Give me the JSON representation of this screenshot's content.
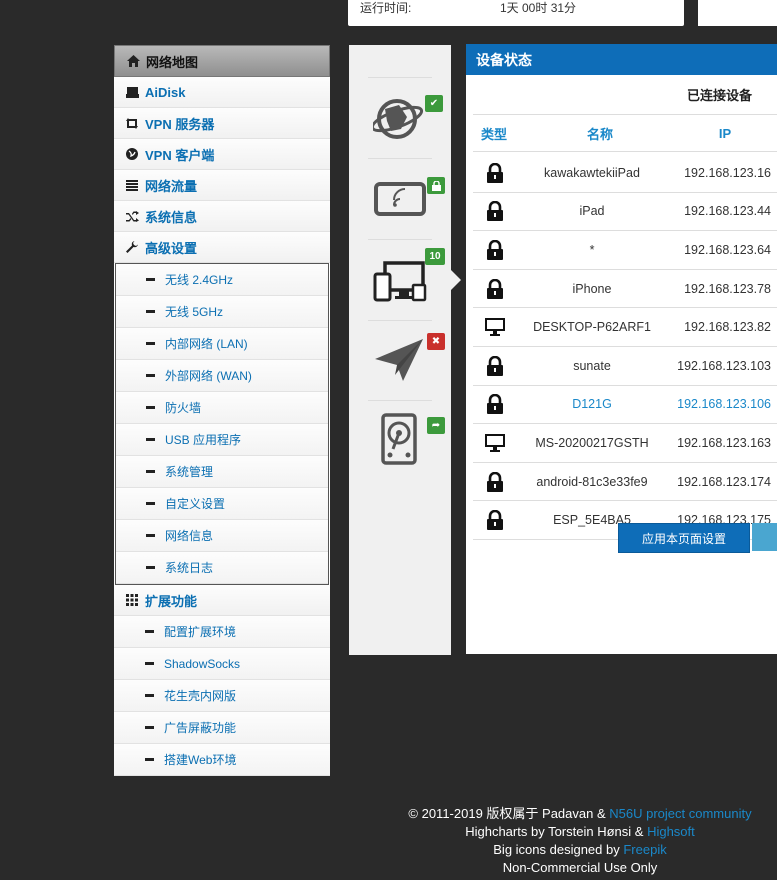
{
  "top": {
    "uptime_label": "运行时间:",
    "uptime_value": "1天 00时 31分"
  },
  "sidebar": {
    "items": [
      {
        "label": "网络地图",
        "icon": "home-icon"
      },
      {
        "label": "AiDisk",
        "icon": "disk-icon"
      },
      {
        "label": "VPN 服务器",
        "icon": "retweet-icon"
      },
      {
        "label": "VPN 客户端",
        "icon": "globe-icon"
      },
      {
        "label": "网络流量",
        "icon": "list-icon"
      },
      {
        "label": "系统信息",
        "icon": "random-icon"
      },
      {
        "label": "高级设置",
        "icon": "wrench-icon"
      }
    ],
    "advanced": [
      "无线 2.4GHz",
      "无线 5GHz",
      "内部网络 (LAN)",
      "外部网络 (WAN)",
      "防火墙",
      "USB 应用程序",
      "系统管理",
      "自定义设置",
      "网络信息",
      "系统日志"
    ],
    "ext_label": "扩展功能",
    "extensions": [
      "配置扩展环境",
      "ShadowSocks",
      "花生壳内网版",
      "广告屏蔽功能",
      "搭建Web环境"
    ]
  },
  "iconcol": {
    "clients_count": "10"
  },
  "panel": {
    "title": "设备状态",
    "tab": "已连接设备",
    "headers": {
      "type": "类型",
      "name": "名称",
      "ip": "IP"
    },
    "rows": [
      {
        "type": "lock",
        "name": "kawakawtekiiPad",
        "ip": "192.168.123.16"
      },
      {
        "type": "lock",
        "name": "iPad",
        "ip": "192.168.123.44"
      },
      {
        "type": "lock",
        "name": "*",
        "ip": "192.168.123.64"
      },
      {
        "type": "lock",
        "name": "iPhone",
        "ip": "192.168.123.78"
      },
      {
        "type": "pc",
        "name": "DESKTOP-P62ARF1",
        "ip": "192.168.123.82"
      },
      {
        "type": "lock",
        "name": "sunate",
        "ip": "192.168.123.103"
      },
      {
        "type": "lock",
        "name": "D121G",
        "ip": "192.168.123.106"
      },
      {
        "type": "pc",
        "name": "MS-20200217GSTH",
        "ip": "192.168.123.163"
      },
      {
        "type": "lock",
        "name": "android-81c3e33fe9",
        "ip": "192.168.123.174"
      },
      {
        "type": "lock",
        "name": "ESP_5E4BA5",
        "ip": "192.168.123.175"
      }
    ],
    "apply": "应用本页面设置"
  },
  "footer": {
    "line1_a": "© 2011-2019 版权属于 Padavan & ",
    "line1_link": "N56U project community",
    "line2_a": "Highcharts by Torstein Hønsi & ",
    "line2_link": "Highsoft",
    "line3_a": "Big icons designed by ",
    "line3_link": "Freepik",
    "line4": "Non-Commercial Use Only"
  },
  "colors": {
    "accent": "#0e6db8",
    "link": "#1a88c9",
    "ok": "#3c9a3c",
    "error": "#c9302c"
  }
}
